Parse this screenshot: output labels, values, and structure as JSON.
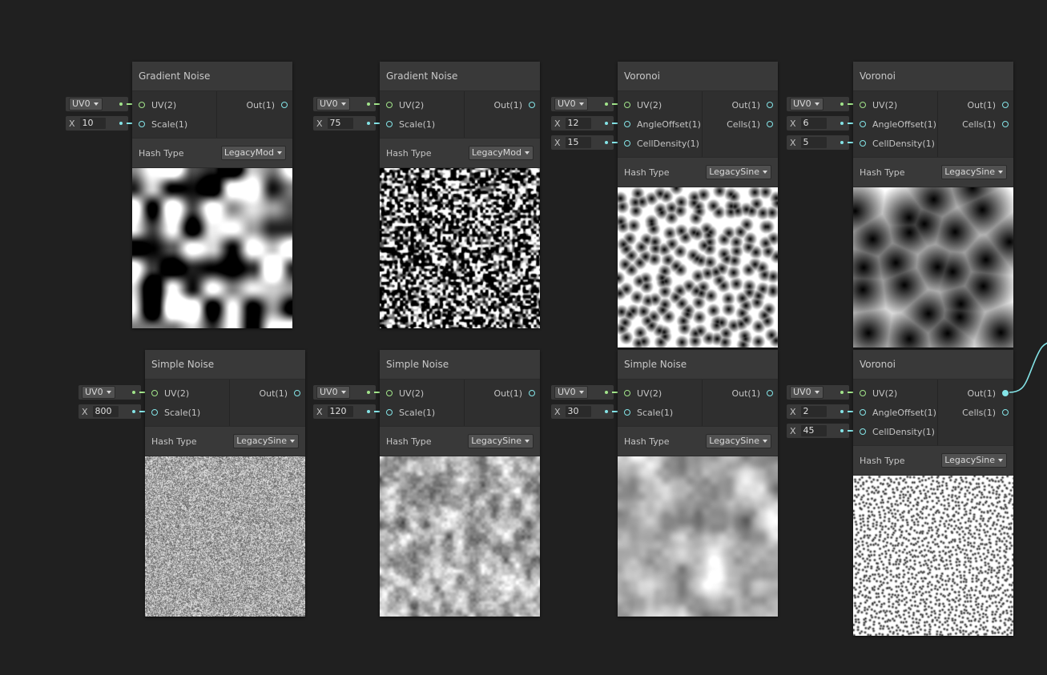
{
  "nodes": [
    {
      "title": "Gradient Noise",
      "inputs": [
        "UV(2)",
        "Scale(1)"
      ],
      "outputs": [
        "Out(1)"
      ],
      "hash_label": "Hash Type",
      "hash": "LegacyMod",
      "uv": "UV0",
      "x_label": "X",
      "vals": [
        "10"
      ]
    },
    {
      "title": "Gradient Noise",
      "inputs": [
        "UV(2)",
        "Scale(1)"
      ],
      "outputs": [
        "Out(1)"
      ],
      "hash_label": "Hash Type",
      "hash": "LegacyMod",
      "uv": "UV0",
      "x_label": "X",
      "vals": [
        "75"
      ]
    },
    {
      "title": "Voronoi",
      "inputs": [
        "UV(2)",
        "AngleOffset(1)",
        "CellDensity(1)"
      ],
      "outputs": [
        "Out(1)",
        "Cells(1)"
      ],
      "hash_label": "Hash Type",
      "hash": "LegacySine",
      "uv": "UV0",
      "x_label": "X",
      "vals": [
        "12",
        "15"
      ]
    },
    {
      "title": "Voronoi",
      "inputs": [
        "UV(2)",
        "AngleOffset(1)",
        "CellDensity(1)"
      ],
      "outputs": [
        "Out(1)",
        "Cells(1)"
      ],
      "hash_label": "Hash Type",
      "hash": "LegacySine",
      "uv": "UV0",
      "x_label": "X",
      "vals": [
        "6",
        "5"
      ]
    },
    {
      "title": "Simple Noise",
      "inputs": [
        "UV(2)",
        "Scale(1)"
      ],
      "outputs": [
        "Out(1)"
      ],
      "hash_label": "Hash Type",
      "hash": "LegacySine",
      "uv": "UV0",
      "x_label": "X",
      "vals": [
        "800"
      ]
    },
    {
      "title": "Simple Noise",
      "inputs": [
        "UV(2)",
        "Scale(1)"
      ],
      "outputs": [
        "Out(1)"
      ],
      "hash_label": "Hash Type",
      "hash": "LegacySine",
      "uv": "UV0",
      "x_label": "X",
      "vals": [
        "120"
      ]
    },
    {
      "title": "Simple Noise",
      "inputs": [
        "UV(2)",
        "Scale(1)"
      ],
      "outputs": [
        "Out(1)"
      ],
      "hash_label": "Hash Type",
      "hash": "LegacySine",
      "uv": "UV0",
      "x_label": "X",
      "vals": [
        "30"
      ]
    },
    {
      "title": "Voronoi",
      "inputs": [
        "UV(2)",
        "AngleOffset(1)",
        "CellDensity(1)"
      ],
      "outputs": [
        "Out(1)",
        "Cells(1)"
      ],
      "hash_label": "Hash Type",
      "hash": "LegacySine",
      "uv": "UV0",
      "x_label": "X",
      "vals": [
        "2",
        "45"
      ]
    }
  ],
  "colors": {
    "canvas": "#202020",
    "node": "#393939",
    "uv_port": "#a2e58a",
    "float_port": "#84e4e7"
  }
}
